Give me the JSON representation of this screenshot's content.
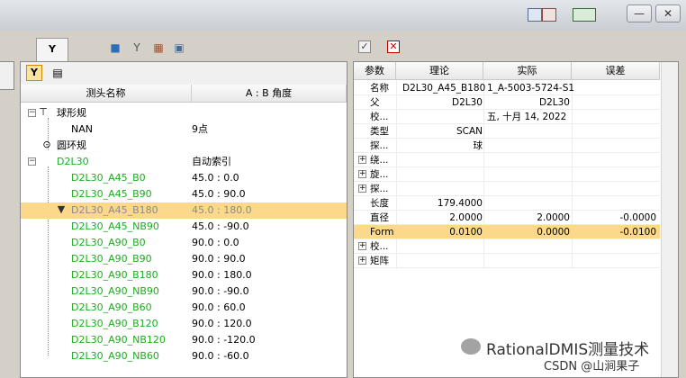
{
  "window": {
    "minimize_glyph": "—",
    "close_glyph": "✕"
  },
  "toolbar": {
    "icons": [
      "probe-tab-icon",
      "cube-icon",
      "stylus-icon",
      "probe-changer-icon",
      "probe-settings-icon"
    ],
    "probe_tab_glyph": "Y",
    "accept_glyph": "✓",
    "reject_glyph": "✕"
  },
  "probe_panel": {
    "header_probe": "测头名称",
    "header_angle": "A : B 角度",
    "rows": [
      {
        "name": "球形规",
        "angle": ""
      },
      {
        "name": "NAN",
        "angle": "9点"
      },
      {
        "name": "圆环规",
        "angle": ""
      },
      {
        "name": "D2L30",
        "angle": "自动索引"
      },
      {
        "name": "D2L30_A45_B0",
        "angle": "45.0 : 0.0"
      },
      {
        "name": "D2L30_A45_B90",
        "angle": "45.0 : 90.0"
      },
      {
        "name": "D2L30_A45_B180",
        "angle": "45.0 : 180.0"
      },
      {
        "name": "D2L30_A45_NB90",
        "angle": "45.0 : -90.0"
      },
      {
        "name": "D2L30_A90_B0",
        "angle": "90.0 : 0.0"
      },
      {
        "name": "D2L30_A90_B90",
        "angle": "90.0 : 90.0"
      },
      {
        "name": "D2L30_A90_B180",
        "angle": "90.0 : 180.0"
      },
      {
        "name": "D2L30_A90_NB90",
        "angle": "90.0 : -90.0"
      },
      {
        "name": "D2L30_A90_B60",
        "angle": "90.0 : 60.0"
      },
      {
        "name": "D2L30_A90_B120",
        "angle": "90.0 : 120.0"
      },
      {
        "name": "D2L30_A90_NB120",
        "angle": "90.0 : -120.0"
      },
      {
        "name": "D2L30_A90_NB60",
        "angle": "90.0 : -60.0"
      }
    ]
  },
  "param_panel": {
    "headers": {
      "param": "参数",
      "theory": "理论",
      "actual": "实际",
      "error": "误差"
    },
    "rows": [
      {
        "key": "名称",
        "theory": "D2L30_A45_B180",
        "actual": "1_A-5003-5724-S1",
        "error": ""
      },
      {
        "key": "父",
        "theory": "D2L30",
        "actual": "D2L30",
        "error": ""
      },
      {
        "key": "校...",
        "theory": "",
        "actual": "五, 十月 14, 2022",
        "error": ""
      },
      {
        "key": "类型",
        "theory": "SCAN",
        "actual": "",
        "error": ""
      },
      {
        "key": "探...",
        "theory": "球",
        "actual": "",
        "error": ""
      },
      {
        "key": "绕...",
        "theory": "",
        "actual": "",
        "error": ""
      },
      {
        "key": "旋...",
        "theory": "",
        "actual": "",
        "error": ""
      },
      {
        "key": "探...",
        "theory": "",
        "actual": "",
        "error": ""
      },
      {
        "key": "长度",
        "theory": "179.4000",
        "actual": "",
        "error": ""
      },
      {
        "key": "直径",
        "theory": "2.0000",
        "actual": "2.0000",
        "error": "-0.0000"
      },
      {
        "key": "Form",
        "theory": "0.0100",
        "actual": "0.0000",
        "error": "-0.0100"
      },
      {
        "key": "校...",
        "theory": "",
        "actual": "",
        "error": ""
      },
      {
        "key": "矩阵",
        "theory": "",
        "actual": "",
        "error": ""
      }
    ]
  },
  "watermark": {
    "brand": "RationalDMIS测量技术",
    "csdn": "CSDN @山涧果子"
  },
  "colors": {
    "selection": "#fcd98a",
    "tree_green": "#1faa1f"
  }
}
